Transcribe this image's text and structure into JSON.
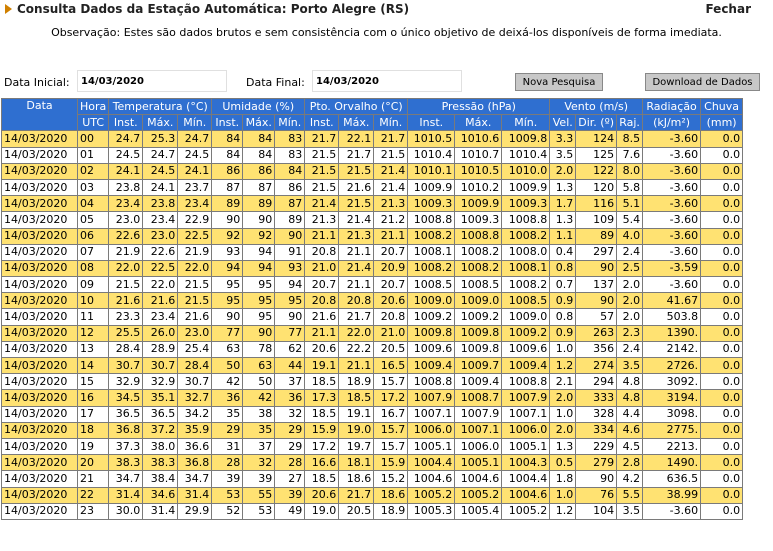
{
  "header": {
    "title": "Consulta Dados da Estação Automática: Porto Alegre (RS)",
    "close_label": "Fechar",
    "observation": "Observação: Estes são dados brutos e sem consistência com o único objetivo de deixá-los disponíveis de forma imediata."
  },
  "filters": {
    "start_label": "Data Inicial:",
    "start_value": "14/03/2020",
    "end_label": "Data Final:",
    "end_value": "14/03/2020",
    "new_search_label": "Nova Pesquisa",
    "download_label": "Download de Dados"
  },
  "colors": {
    "header_bg": "#2f6fd0",
    "row_highlight": "#ffe272"
  },
  "table": {
    "group_headers": [
      "Data",
      "Hora",
      "Temperatura (°C)",
      "Umidade (%)",
      "Pto. Orvalho (°C)",
      "Pressão (hPa)",
      "Vento (m/s)",
      "Radiação",
      "Chuva"
    ],
    "sub_headers": [
      "UTC",
      "Inst.",
      "Máx.",
      "Mín.",
      "Inst.",
      "Máx.",
      "Mín.",
      "Inst.",
      "Máx.",
      "Mín.",
      "Inst.",
      "Máx.",
      "Mín.",
      "Vel.",
      "Dir. (º)",
      "Raj.",
      "(kJ/m²)",
      "(mm)"
    ],
    "rows": [
      [
        "14/03/2020",
        "00",
        "24.7",
        "25.3",
        "24.7",
        "84",
        "84",
        "83",
        "21.7",
        "22.1",
        "21.7",
        "1010.5",
        "1010.6",
        "1009.8",
        "3.3",
        "124",
        "8.5",
        "-3.60",
        "0.0"
      ],
      [
        "14/03/2020",
        "01",
        "24.5",
        "24.7",
        "24.5",
        "84",
        "84",
        "83",
        "21.5",
        "21.7",
        "21.5",
        "1010.4",
        "1010.7",
        "1010.4",
        "3.5",
        "125",
        "7.6",
        "-3.60",
        "0.0"
      ],
      [
        "14/03/2020",
        "02",
        "24.1",
        "24.5",
        "24.1",
        "86",
        "86",
        "84",
        "21.5",
        "21.5",
        "21.4",
        "1010.1",
        "1010.5",
        "1010.0",
        "2.0",
        "122",
        "8.0",
        "-3.60",
        "0.0"
      ],
      [
        "14/03/2020",
        "03",
        "23.8",
        "24.1",
        "23.7",
        "87",
        "87",
        "86",
        "21.5",
        "21.6",
        "21.4",
        "1009.9",
        "1010.2",
        "1009.9",
        "1.3",
        "120",
        "5.8",
        "-3.60",
        "0.0"
      ],
      [
        "14/03/2020",
        "04",
        "23.4",
        "23.8",
        "23.4",
        "89",
        "89",
        "87",
        "21.4",
        "21.5",
        "21.3",
        "1009.3",
        "1009.9",
        "1009.3",
        "1.7",
        "116",
        "5.1",
        "-3.60",
        "0.0"
      ],
      [
        "14/03/2020",
        "05",
        "23.0",
        "23.4",
        "22.9",
        "90",
        "90",
        "89",
        "21.3",
        "21.4",
        "21.2",
        "1008.8",
        "1009.3",
        "1008.8",
        "1.3",
        "109",
        "5.4",
        "-3.60",
        "0.0"
      ],
      [
        "14/03/2020",
        "06",
        "22.6",
        "23.0",
        "22.5",
        "92",
        "92",
        "90",
        "21.1",
        "21.3",
        "21.1",
        "1008.2",
        "1008.8",
        "1008.2",
        "1.1",
        "89",
        "4.0",
        "-3.60",
        "0.0"
      ],
      [
        "14/03/2020",
        "07",
        "21.9",
        "22.6",
        "21.9",
        "93",
        "94",
        "91",
        "20.8",
        "21.1",
        "20.7",
        "1008.1",
        "1008.2",
        "1008.0",
        "0.4",
        "297",
        "2.4",
        "-3.60",
        "0.0"
      ],
      [
        "14/03/2020",
        "08",
        "22.0",
        "22.5",
        "22.0",
        "94",
        "94",
        "93",
        "21.0",
        "21.4",
        "20.9",
        "1008.2",
        "1008.2",
        "1008.1",
        "0.8",
        "90",
        "2.5",
        "-3.59",
        "0.0"
      ],
      [
        "14/03/2020",
        "09",
        "21.5",
        "22.0",
        "21.5",
        "95",
        "95",
        "94",
        "20.7",
        "21.1",
        "20.7",
        "1008.5",
        "1008.5",
        "1008.2",
        "0.7",
        "137",
        "2.0",
        "-3.60",
        "0.0"
      ],
      [
        "14/03/2020",
        "10",
        "21.6",
        "21.6",
        "21.5",
        "95",
        "95",
        "95",
        "20.8",
        "20.8",
        "20.6",
        "1009.0",
        "1009.0",
        "1008.5",
        "0.9",
        "90",
        "2.0",
        "41.67",
        "0.0"
      ],
      [
        "14/03/2020",
        "11",
        "23.3",
        "23.4",
        "21.6",
        "90",
        "95",
        "90",
        "21.6",
        "21.7",
        "20.8",
        "1009.2",
        "1009.2",
        "1009.0",
        "0.8",
        "57",
        "2.0",
        "503.8",
        "0.0"
      ],
      [
        "14/03/2020",
        "12",
        "25.5",
        "26.0",
        "23.0",
        "77",
        "90",
        "77",
        "21.1",
        "22.0",
        "21.0",
        "1009.8",
        "1009.8",
        "1009.2",
        "0.9",
        "263",
        "2.3",
        "1390.",
        "0.0"
      ],
      [
        "14/03/2020",
        "13",
        "28.4",
        "28.9",
        "25.4",
        "63",
        "78",
        "62",
        "20.6",
        "22.2",
        "20.5",
        "1009.6",
        "1009.8",
        "1009.6",
        "1.0",
        "356",
        "2.4",
        "2142.",
        "0.0"
      ],
      [
        "14/03/2020",
        "14",
        "30.7",
        "30.7",
        "28.4",
        "50",
        "63",
        "44",
        "19.1",
        "21.1",
        "16.5",
        "1009.4",
        "1009.7",
        "1009.4",
        "1.2",
        "274",
        "3.5",
        "2726.",
        "0.0"
      ],
      [
        "14/03/2020",
        "15",
        "32.9",
        "32.9",
        "30.7",
        "42",
        "50",
        "37",
        "18.5",
        "18.9",
        "15.7",
        "1008.8",
        "1009.4",
        "1008.8",
        "2.1",
        "294",
        "4.8",
        "3092.",
        "0.0"
      ],
      [
        "14/03/2020",
        "16",
        "34.5",
        "35.1",
        "32.7",
        "36",
        "42",
        "36",
        "17.3",
        "18.5",
        "17.2",
        "1007.9",
        "1008.7",
        "1007.9",
        "2.0",
        "333",
        "4.8",
        "3194.",
        "0.0"
      ],
      [
        "14/03/2020",
        "17",
        "36.5",
        "36.5",
        "34.2",
        "35",
        "38",
        "32",
        "18.5",
        "19.1",
        "16.7",
        "1007.1",
        "1007.9",
        "1007.1",
        "1.0",
        "328",
        "4.4",
        "3098.",
        "0.0"
      ],
      [
        "14/03/2020",
        "18",
        "36.8",
        "37.2",
        "35.9",
        "29",
        "35",
        "29",
        "15.9",
        "19.0",
        "15.7",
        "1006.0",
        "1007.1",
        "1006.0",
        "2.0",
        "334",
        "4.6",
        "2775.",
        "0.0"
      ],
      [
        "14/03/2020",
        "19",
        "37.3",
        "38.0",
        "36.6",
        "31",
        "37",
        "29",
        "17.2",
        "19.7",
        "15.7",
        "1005.1",
        "1006.0",
        "1005.1",
        "1.3",
        "229",
        "4.5",
        "2213.",
        "0.0"
      ],
      [
        "14/03/2020",
        "20",
        "38.3",
        "38.3",
        "36.8",
        "28",
        "32",
        "28",
        "16.6",
        "18.1",
        "15.9",
        "1004.4",
        "1005.1",
        "1004.3",
        "0.5",
        "279",
        "2.8",
        "1490.",
        "0.0"
      ],
      [
        "14/03/2020",
        "21",
        "34.7",
        "38.4",
        "34.7",
        "39",
        "39",
        "27",
        "18.5",
        "18.6",
        "15.2",
        "1004.6",
        "1004.6",
        "1004.4",
        "1.8",
        "90",
        "4.2",
        "636.5",
        "0.0"
      ],
      [
        "14/03/2020",
        "22",
        "31.4",
        "34.6",
        "31.4",
        "53",
        "55",
        "39",
        "20.6",
        "21.7",
        "18.6",
        "1005.2",
        "1005.2",
        "1004.6",
        "1.0",
        "76",
        "5.5",
        "38.99",
        "0.0"
      ],
      [
        "14/03/2020",
        "23",
        "30.0",
        "31.4",
        "29.9",
        "52",
        "53",
        "49",
        "19.0",
        "20.5",
        "18.9",
        "1005.3",
        "1005.4",
        "1005.2",
        "1.2",
        "104",
        "3.5",
        "-3.60",
        "0.0"
      ]
    ]
  }
}
